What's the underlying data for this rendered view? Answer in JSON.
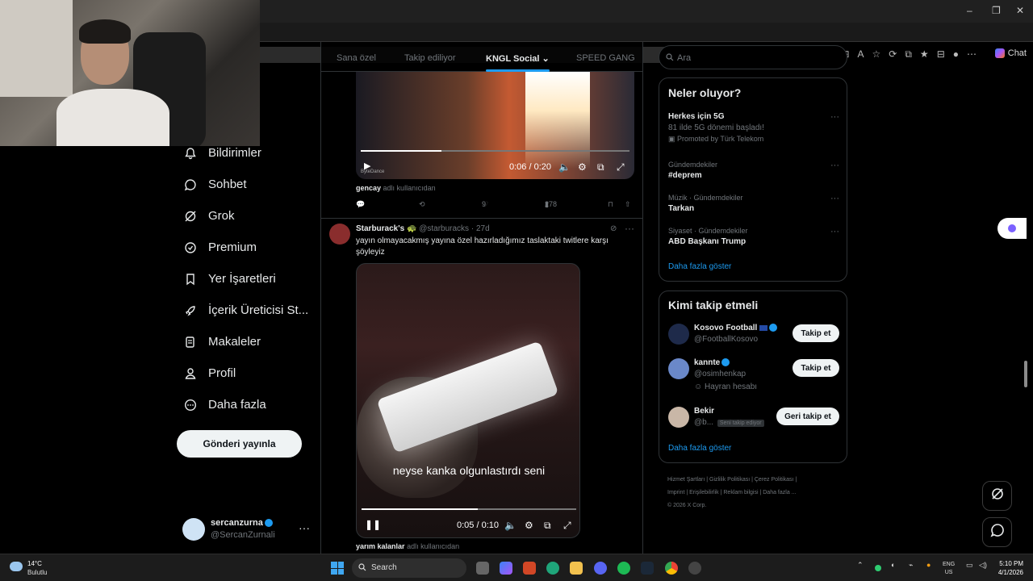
{
  "browser": {
    "chat_label": "Chat",
    "window_controls": [
      "–",
      "❐",
      "✕"
    ]
  },
  "sidebar": {
    "items": [
      {
        "label": "Bildirimler",
        "icon": "bell-icon"
      },
      {
        "label": "Sohbet",
        "icon": "chat-icon"
      },
      {
        "label": "Grok",
        "icon": "grok-icon"
      },
      {
        "label": "Premium",
        "icon": "premium-icon"
      },
      {
        "label": "Yer İşaretleri",
        "icon": "bookmark-icon"
      },
      {
        "label": "İçerik Üreticisi St...",
        "icon": "rocket-icon"
      },
      {
        "label": "Makaleler",
        "icon": "article-icon"
      },
      {
        "label": "Profil",
        "icon": "person-icon"
      },
      {
        "label": "Daha fazla",
        "icon": "more-circle-icon"
      }
    ],
    "post_button": "Gönderi yayınla",
    "account": {
      "name": "sercanzurna",
      "handle": "@SercanZurnali",
      "more": "···"
    }
  },
  "feed": {
    "tabs": [
      "Sana özel",
      "Takip ediliyor",
      "KNGL Social",
      "SPEED GANG"
    ],
    "active_tab": 2,
    "post1": {
      "video_time": "0:06 / 0:20",
      "video_progress": 0.3,
      "watermark": "ByteDance",
      "credit_user": "gencay",
      "credit_suffix": "adlı kullanıcıdan",
      "likes": "9",
      "views": "278"
    },
    "post2": {
      "name": "Starburack's",
      "name_emoji": "🐢",
      "handle": "@starburacks",
      "dot": "·",
      "time": "27d",
      "text": "yayın olmayacakmış yayına özel hazırladığımız taslaktaki twitlere karşı şöyleyiz",
      "subtitle": "neyse kanka olgunlastırdı seni",
      "video_time": "0:05 / 0:10",
      "video_progress": 0.54,
      "credit_user": "yarım kalanlar",
      "credit_suffix": "adlı kullanıcıdan"
    }
  },
  "right": {
    "search_placeholder": "Ara",
    "trends_title": "Neler oluyor?",
    "trends": [
      {
        "context": "",
        "title": "Herkes için 5G",
        "subtitle": "81 ilde 5G dönemi başladı!",
        "promoted": "Promoted by Türk Telekom"
      },
      {
        "context": "Gündemdekiler",
        "title": "#deprem"
      },
      {
        "context": "Müzik · Gündemdekiler",
        "title": "Tarkan"
      },
      {
        "context": "Siyaset · Gündemdekiler",
        "title": "ABD Başkanı Trump"
      }
    ],
    "trends_more": "Daha fazla göster",
    "who_title": "Kimi takip etmeli",
    "who": [
      {
        "name": "Kosovo Football",
        "handle": "@FootballKosovo",
        "button": "Takip et",
        "extra": ""
      },
      {
        "name": "kannte",
        "handle": "@osimhenkap",
        "button": "Takip et",
        "extra": "Hayran hesabı"
      },
      {
        "name": "Bekir",
        "handle": "@b...",
        "button": "Geri takip et",
        "extra": "",
        "tag": "Seni takip ediyor"
      }
    ],
    "who_more": "Daha fazla göster",
    "footer": {
      "line1": "Hizmet Şartları  |  Gizlilik Politikası  |  Çerez Politikası  |",
      "line2": "Imprint  |  Erişilebilirlik  |  Reklam bilgisi  |  Daha fazla ...",
      "line3": "© 2026 X Corp."
    }
  },
  "taskbar": {
    "temp": "14°C",
    "weather": "Bulutlu",
    "search": "Search",
    "lang1": "ENG",
    "lang2": "US",
    "time": "5:10 PM",
    "date": "4/1/2026"
  },
  "colors": {
    "accent": "#1d9bf0",
    "bg": "#000000",
    "border": "#2f3336",
    "muted": "#71767b"
  }
}
